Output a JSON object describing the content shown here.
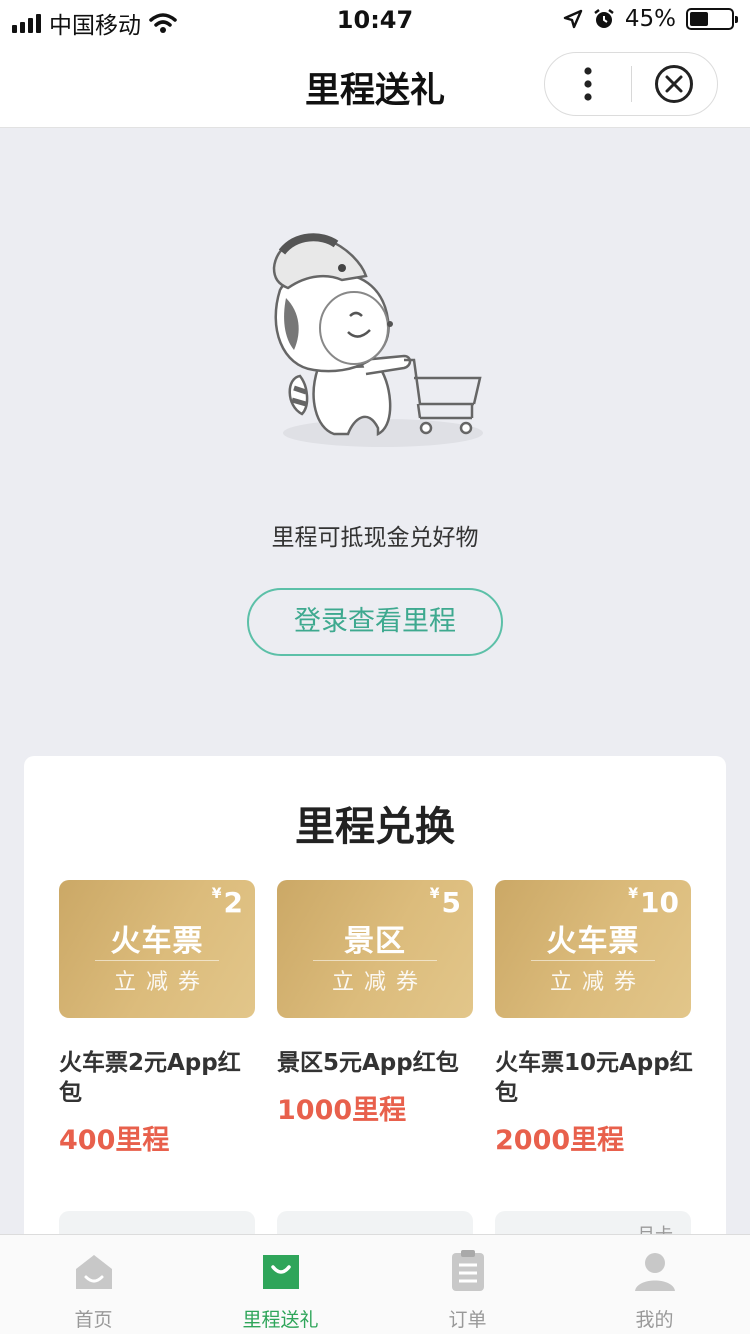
{
  "status_bar": {
    "carrier": "中国移动",
    "time": "10:47",
    "battery": "45%",
    "battery_level": 0.45
  },
  "nav": {
    "title": "里程送礼",
    "more_icon": "more-vertical-icon",
    "close_icon": "close-circle-icon"
  },
  "hero": {
    "message": "里程可抵现金兑好物",
    "login_label": "登录查看里程",
    "accent": "#3ea98f"
  },
  "exchange": {
    "title": "里程兑换",
    "items": [
      {
        "coupon_currency": "¥",
        "coupon_amount": "2",
        "coupon_name": "火车票",
        "coupon_sub": "立减券",
        "name": "火车票2元App红包",
        "price": "400里程"
      },
      {
        "coupon_currency": "¥",
        "coupon_amount": "5",
        "coupon_name": "景区",
        "coupon_sub": "立减券",
        "name": "景区5元App红包",
        "price": "1000里程"
      },
      {
        "coupon_currency": "¥",
        "coupon_amount": "10",
        "coupon_name": "火车票",
        "coupon_sub": "立减券",
        "name": "火车票10元App红包",
        "price": "2000里程"
      }
    ],
    "peek_label": "月卡"
  },
  "tab_bar": {
    "active_color": "#2fa55a",
    "tabs": [
      {
        "label": "首页",
        "icon": "home-icon"
      },
      {
        "label": "里程送礼",
        "icon": "shopping-bag-icon"
      },
      {
        "label": "订单",
        "icon": "order-list-icon"
      },
      {
        "label": "我的",
        "icon": "user-icon"
      }
    ]
  }
}
